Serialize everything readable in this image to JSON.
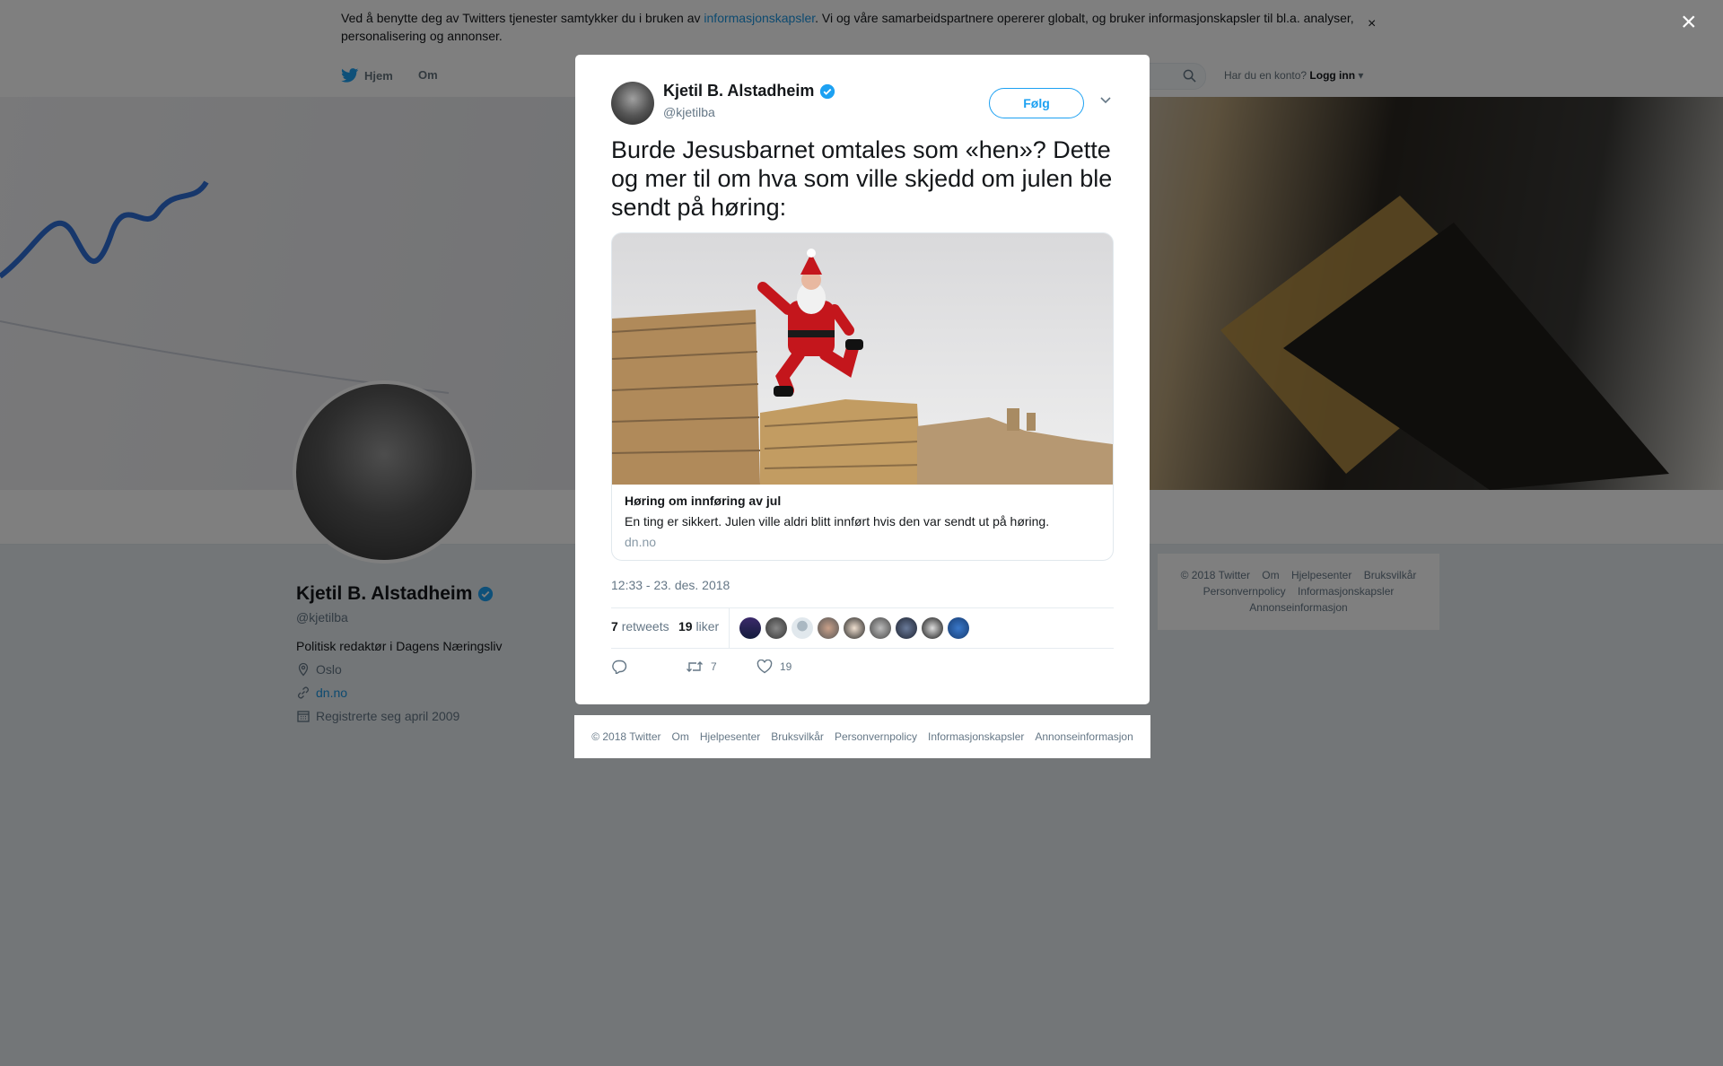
{
  "cookie_banner": {
    "text_before": "Ved å benytte deg av Twitters tjenester samtykker du i bruken av ",
    "link": "informasjonskapsler",
    "text_after": ". Vi og våre samarbeidspartnere opererer globalt, og bruker informasjonskapsler til bl.a. analyser, personalisering og annonser.",
    "close": "×"
  },
  "nav": {
    "home": "Hjem",
    "about": "Om",
    "login_prompt": "Har du en konto?",
    "login": "Logg inn"
  },
  "profile": {
    "name": "Kjetil B. Alstadheim",
    "handle": "@kjetilba",
    "bio": "Politisk redaktør i Dagens Næringsliv",
    "location": "Oslo",
    "website": "dn.no",
    "joined": "Registrerte seg april 2009"
  },
  "side_footer": {
    "items": [
      "© 2018 Twitter",
      "Om",
      "Hjelpesenter",
      "Bruksvilkår",
      "Personvernpolicy",
      "Informasjonskapsler",
      "Annonseinformasjon"
    ]
  },
  "overlay": {
    "close": "×"
  },
  "tweet": {
    "author_name": "Kjetil B. Alstadheim",
    "author_handle": "@kjetilba",
    "follow_label": "Følg",
    "text": "Burde Jesusbarnet omtales som «hen»? Dette og mer til om hva som ville skjedd om julen ble sendt på høring:",
    "card": {
      "title": "Høring om innføring av jul",
      "description": "En ting er sikkert. Julen ville aldri blitt innført hvis den var sendt ut på høring.",
      "domain": "dn.no"
    },
    "timestamp": "12:33 - 23. des. 2018",
    "retweets": "7",
    "retweets_label": "retweets",
    "likes": "19",
    "likes_label": "liker",
    "action_retweets": "7",
    "action_likes": "19",
    "colors": {
      "accent": "#1da1f2",
      "link": "#1b95e0"
    }
  },
  "modal_footer": {
    "items": [
      "© 2018 Twitter",
      "Om",
      "Hjelpesenter",
      "Bruksvilkår",
      "Personvernpolicy",
      "Informasjonskapsler",
      "Annonseinformasjon"
    ]
  }
}
